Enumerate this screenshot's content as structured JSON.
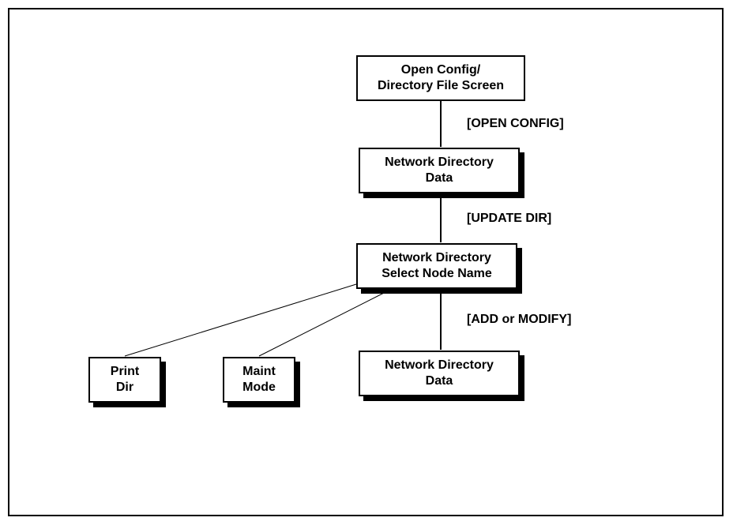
{
  "boxes": {
    "open_config": {
      "line1": "Open Config/",
      "line2": "Directory File Screen"
    },
    "net_dir_data_1": {
      "line1": "Network Directory",
      "line2": "Data"
    },
    "net_dir_select": {
      "line1": "Network Directory",
      "line2": "Select Node Name"
    },
    "net_dir_data_2": {
      "line1": "Network Directory",
      "line2": "Data"
    },
    "print_dir": {
      "line1": "Print",
      "line2": "Dir"
    },
    "maint_mode": {
      "line1": "Maint",
      "line2": "Mode"
    }
  },
  "edges": {
    "open_config": "[OPEN CONFIG]",
    "update_dir": "[UPDATE DIR]",
    "add_modify": "[ADD or MODIFY]"
  }
}
